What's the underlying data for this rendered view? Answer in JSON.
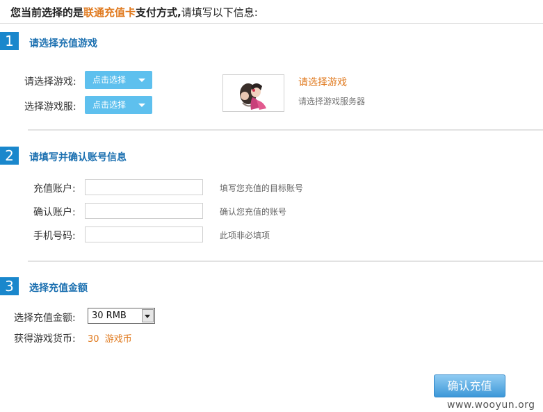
{
  "intro": {
    "prefix": "您当前选择的是",
    "method": "联通充值卡",
    "suffix": "支付方式,",
    "note": "请填写以下信息:"
  },
  "section1": {
    "number": "1",
    "title": "请选择充值游戏",
    "game_label": "请选择游戏:",
    "server_label": "选择游戏服:",
    "game_button": "点击选择",
    "server_button": "点击选择",
    "game_name": "请选择游戏",
    "game_server": "请选择游戏服务器"
  },
  "section2": {
    "number": "2",
    "title": "请填写并确认账号信息",
    "fields": [
      {
        "label": "充值账户:",
        "value": "",
        "hint": "填写您充值的目标账号"
      },
      {
        "label": "确认账户:",
        "value": "",
        "hint": "确认您充值的账号"
      },
      {
        "label": "手机号码:",
        "value": "",
        "hint": "此项非必填项"
      }
    ]
  },
  "section3": {
    "number": "3",
    "title": "选择充值金额",
    "amount_label": "选择充值金额:",
    "amount_value": "30 RMB",
    "currency_label": "获得游戏货币:",
    "currency_value": "30  游戏币"
  },
  "confirm_button": "确认充值",
  "watermark": "www.wooyun.org",
  "colors": {
    "accent_blue": "#1a87cc",
    "title_blue": "#1a6fb0",
    "orange": "#e07a1f",
    "select_button": "#5ec0ee"
  },
  "icons": [
    "chevron-down-icon",
    "game-character-image"
  ]
}
